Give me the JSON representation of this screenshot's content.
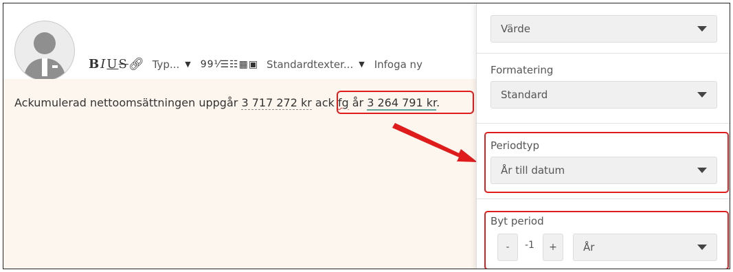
{
  "toolbar": {
    "bold": "B",
    "italic": "I",
    "underline": "U",
    "strike": "S",
    "link_icon": "link-icon",
    "type_label": "Typ...",
    "blocks_icons": "99⅟☰☷▦▣",
    "std_texts_label": "Standardtexter...",
    "insert_label": "Infoga ny"
  },
  "content": {
    "text_prefix": "Ackumulerad nettoomsättningen uppgår ",
    "value1": "3 717 272 kr",
    "text_mid": " ack ",
    "fg": "fg",
    "text_year": " år ",
    "value2": "3 264 791 kr",
    "text_end": "."
  },
  "panel": {
    "value_select": "Värde",
    "formatting_label": "Formatering",
    "formatting_select": "Standard",
    "periodtype_label": "Periodtyp",
    "periodtype_select": "År till datum",
    "change_period_label": "Byt period",
    "minus": "-",
    "step_value": "-1",
    "plus": "+",
    "period_unit_select": "År"
  },
  "colors": {
    "highlight": "#e01b1b",
    "content_bg": "#fdf6ee",
    "arrow": "#e01b1b"
  }
}
